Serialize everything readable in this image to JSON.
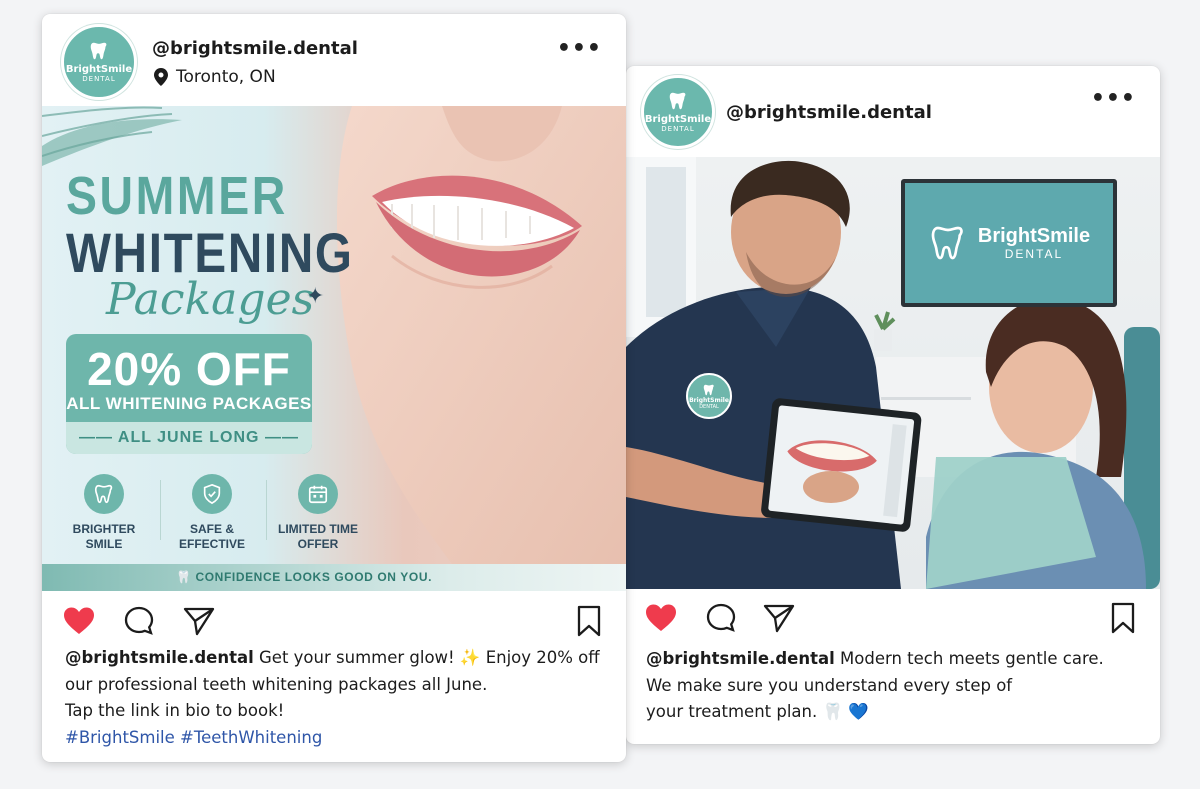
{
  "posts": [
    {
      "username": "@brightsmile.dental",
      "location": "Toronto, ON",
      "avatar": {
        "brand": "BrightSmile",
        "sub": "DENTAL"
      },
      "image": {
        "headline_line1": "SUMMER",
        "headline_line2": "WHITENING",
        "headline_line3": "Packages",
        "offer_main": "20% OFF",
        "offer_sub": "ALL WHITENING PACKAGES",
        "offer_band": "—— ALL JUNE LONG ——",
        "features": [
          {
            "icon": "tooth-icon",
            "line1": "BRIGHTER",
            "line2": "SMILE"
          },
          {
            "icon": "shield-icon",
            "line1": "SAFE &",
            "line2": "EFFECTIVE"
          },
          {
            "icon": "calendar-icon",
            "line1": "LIMITED TIME",
            "line2": "OFFER"
          }
        ],
        "bottom_band": "CONFIDENCE LOOKS GOOD ON YOU."
      },
      "caption": {
        "user": "@brightsmile.dental",
        "text": "Get your summer glow! ✨ Enjoy 20% off our professional teeth whitening packages all June.",
        "line3": "Tap the link in bio to book!",
        "hashtags": "#BrightSmile #TeethWhitening"
      }
    },
    {
      "username": "@brightsmile.dental",
      "avatar": {
        "brand": "BrightSmile",
        "sub": "DENTAL"
      },
      "image": {
        "tv_brand": "BrightSmile",
        "tv_sub": "DENTAL",
        "badge_brand": "BrightSmile",
        "badge_sub": "DENTAL"
      },
      "caption": {
        "user": "@brightsmile.dental",
        "line1": "Modern tech meets gentle care.",
        "line2": "We make sure you understand every step of",
        "line3": "your treatment plan. 🦷 💙"
      }
    }
  ],
  "colors": {
    "accent": "#6eb6ab",
    "heart": "#ef3b4d",
    "hashtag": "#2f56a8",
    "headline_dark": "#2f4a5e"
  }
}
